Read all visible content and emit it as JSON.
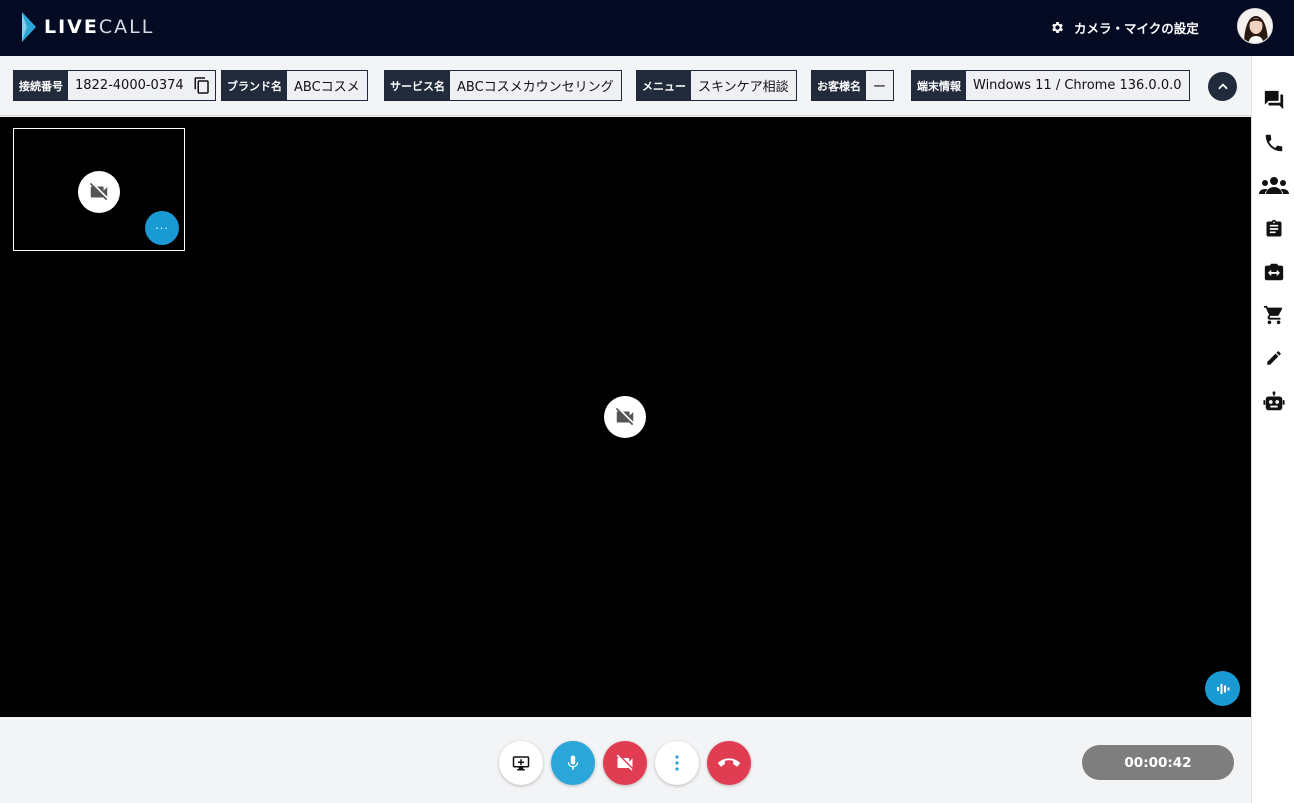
{
  "app": {
    "logo_text_bold": "LIVE",
    "logo_text_light": "CALL",
    "settings_label": "カメラ・マイクの設定",
    "settings_icon": "gear-icon",
    "avatar": "user-avatar"
  },
  "info": {
    "connection": {
      "label": "接続番号",
      "value": "1822-4000-0374"
    },
    "brand": {
      "label": "ブランド名",
      "value": "ABCコスメ"
    },
    "service": {
      "label": "サービス名",
      "value": "ABCコスメカウンセリング"
    },
    "menu": {
      "label": "メニュー",
      "value": "スキンケア相談"
    },
    "customer": {
      "label": "お客様名",
      "value": "ー"
    },
    "device": {
      "label": "端末情報",
      "value": "Windows 11 / Chrome 136.0.0.0"
    }
  },
  "video": {
    "pip_menu_label": "···"
  },
  "call": {
    "timer": "00:00:42"
  },
  "colors": {
    "topbar": "#050b22",
    "chip_label": "#222b3b",
    "accent_blue": "#1a9ad2",
    "mic_blue": "#2aa6d9",
    "danger_red": "#e03c52",
    "timer_gray": "#7e7e7e"
  },
  "rail_icons": [
    "chat-icon",
    "phone-icon",
    "group-icon",
    "clipboard-icon",
    "camera-switch-icon",
    "cart-icon",
    "edit-icon",
    "robot-icon"
  ]
}
